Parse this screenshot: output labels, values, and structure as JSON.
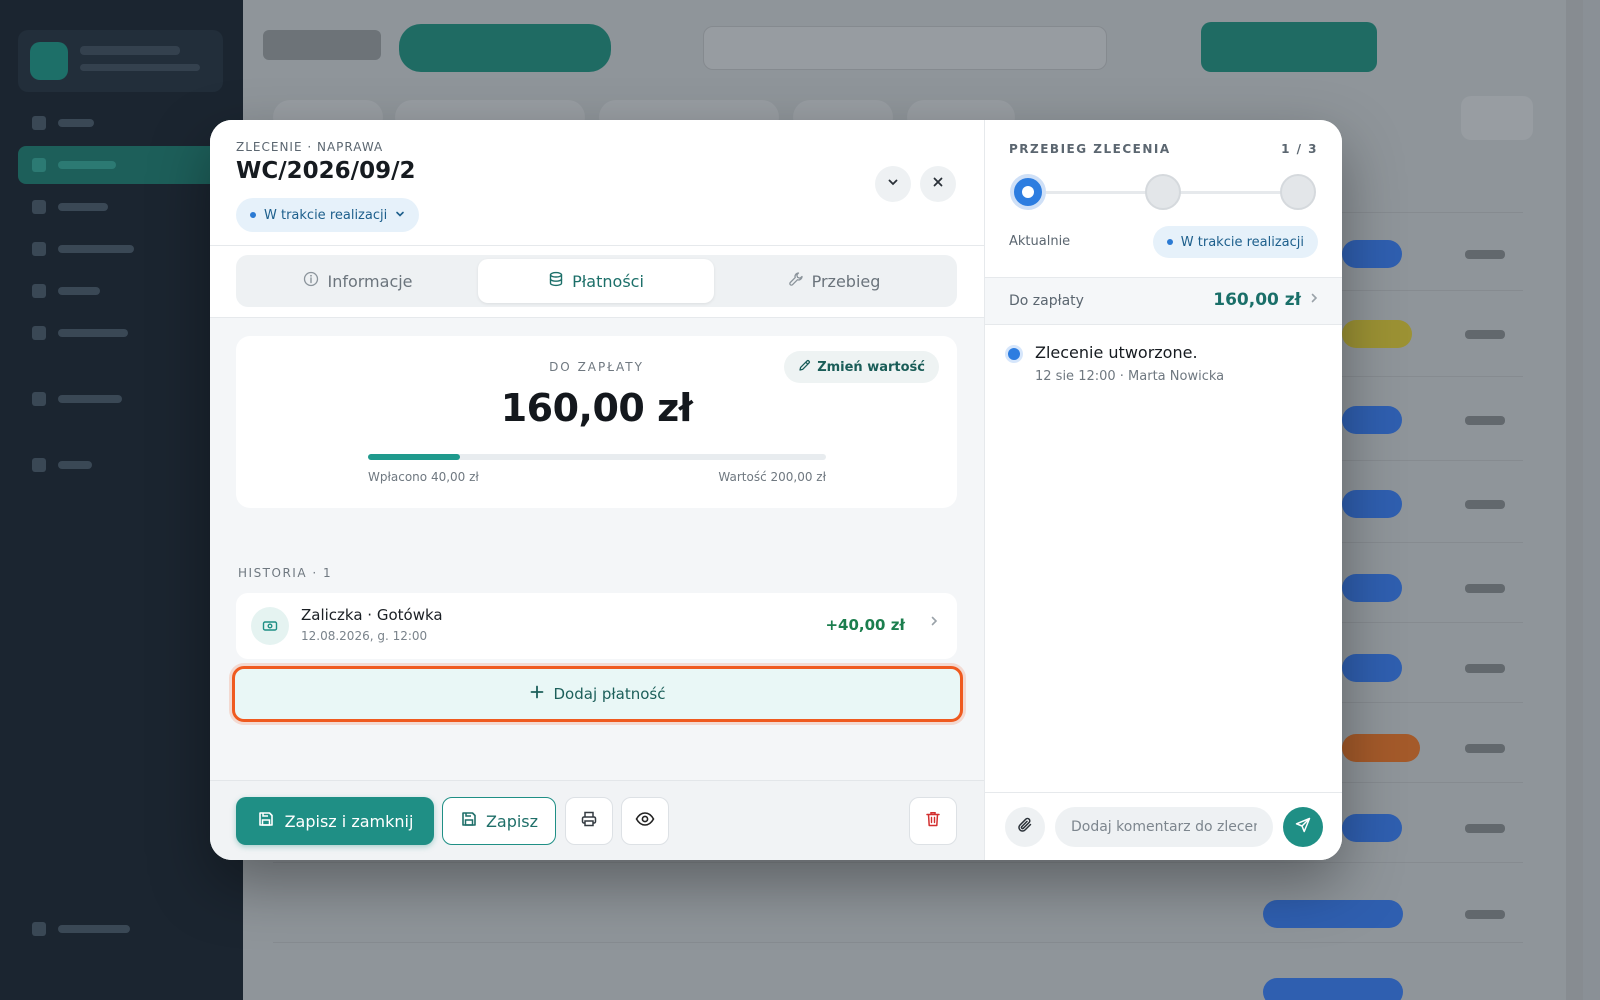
{
  "modal": {
    "eyebrow": "ZLECENIE · NAPRAWA",
    "order_number": "WC/2026/09/2",
    "status": "W trakcie realizacji"
  },
  "tabs": [
    {
      "label": "Informacje",
      "icon": "info-icon",
      "active": false
    },
    {
      "label": "Płatności",
      "icon": "database-icon",
      "active": true
    },
    {
      "label": "Przebieg",
      "icon": "wrench-icon",
      "active": false
    }
  ],
  "payment": {
    "due_label": "DO ZAPŁATY",
    "due_amount": "160,00 zł",
    "edit_label": "Zmień wartość",
    "paid_label": "Wpłacono 40,00 zł",
    "value_label": "Wartość 200,00 zł",
    "paid_fraction": 0.2
  },
  "history": {
    "label": "HISTORIA · 1",
    "items": [
      {
        "title": "Zaliczka · Gotówka",
        "date": "12.08.2026, g. 12:00",
        "amount": "+40,00 zł"
      }
    ],
    "add_label": "Dodaj płatność"
  },
  "footer": {
    "save_close_label": "Zapisz i zamknij",
    "save_label": "Zapisz"
  },
  "progress_panel": {
    "title": "PRZEBIEG ZLECENIA",
    "count": "1 / 3",
    "current_label": "Aktualnie",
    "current_status": "W trakcie realizacji",
    "due_label": "Do zapłaty",
    "due_value": "160,00 zł",
    "timeline": [
      {
        "title": "Zlecenie utworzone.",
        "meta": "12 sie 12:00 · Marta Nowicka"
      }
    ],
    "comment_placeholder": "Dodaj komentarz do zlecenia..."
  },
  "colors": {
    "accent": "#1f8f85",
    "status_blue": "#2d7de0",
    "highlight": "#ef5a1f"
  }
}
